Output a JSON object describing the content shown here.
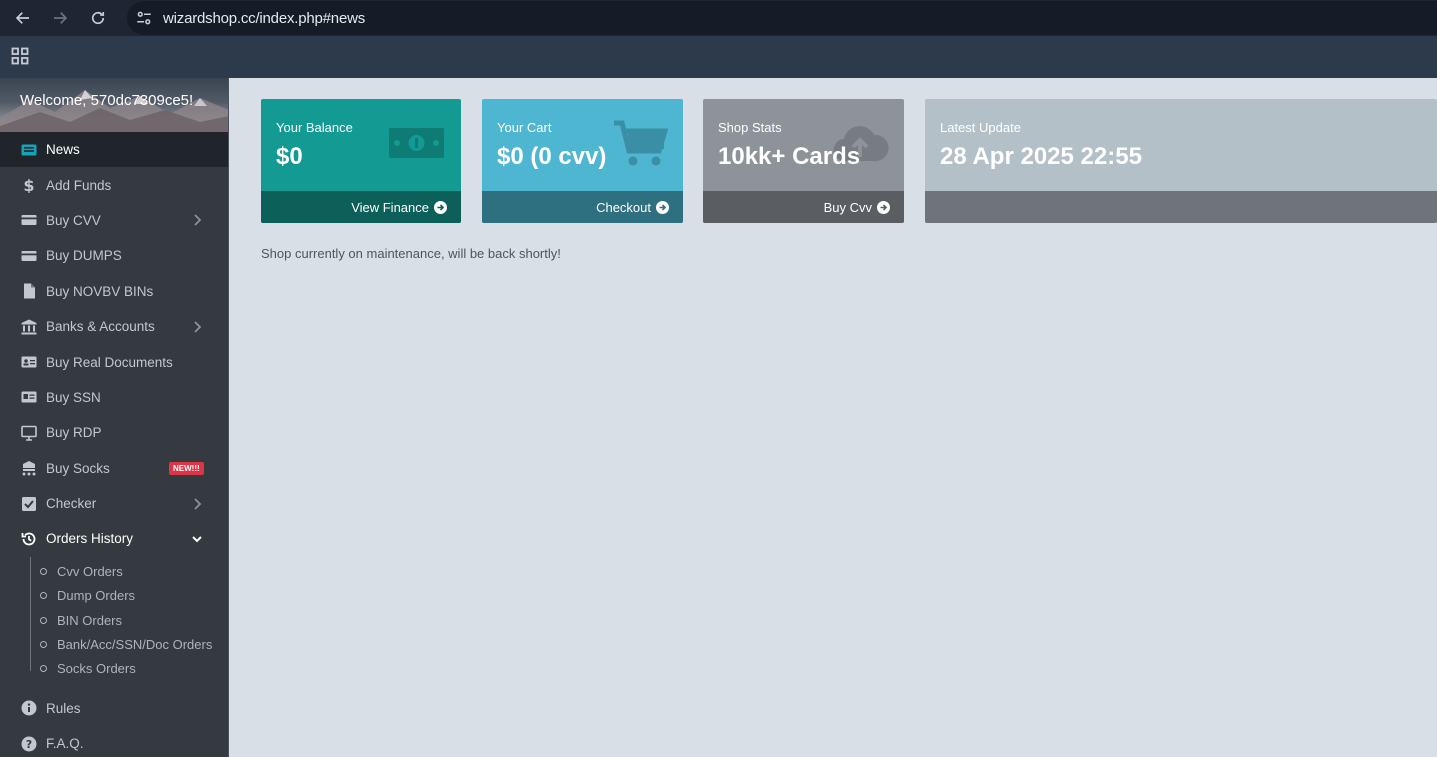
{
  "browser": {
    "url": "wizardshop.cc/index.php#news"
  },
  "sidebar": {
    "welcome": "Welcome, 570dc7309ce5!",
    "items": [
      {
        "label": "News",
        "icon": "newspaper-icon",
        "active": true
      },
      {
        "label": "Add Funds",
        "icon": "dollar-icon"
      },
      {
        "label": "Buy CVV",
        "icon": "credit-card-icon",
        "has_arrow": true
      },
      {
        "label": "Buy DUMPS",
        "icon": "credit-card-icon"
      },
      {
        "label": "Buy NOVBV BINs",
        "icon": "file-icon"
      },
      {
        "label": "Banks & Accounts",
        "icon": "bank-icon",
        "has_arrow": true
      },
      {
        "label": "Buy Real Documents",
        "icon": "id-card-icon"
      },
      {
        "label": "Buy SSN",
        "icon": "id-badge-icon"
      },
      {
        "label": "Buy RDP",
        "icon": "desktop-icon"
      },
      {
        "label": "Buy Socks",
        "icon": "network-icon",
        "badge": "NEW!!!"
      },
      {
        "label": "Checker",
        "icon": "check-square-icon",
        "has_arrow": true
      },
      {
        "label": "Orders History",
        "icon": "history-icon",
        "open": true
      }
    ],
    "orders_submenu": [
      {
        "label": "Cvv Orders"
      },
      {
        "label": "Dump Orders"
      },
      {
        "label": "BIN Orders"
      },
      {
        "label": "Bank/Acc/SSN/Doc Orders"
      },
      {
        "label": "Socks Orders"
      }
    ],
    "bottom_items": [
      {
        "label": "Rules",
        "icon": "info-circle-icon"
      },
      {
        "label": "F.A.Q.",
        "icon": "question-circle-icon"
      }
    ]
  },
  "boxes": {
    "balance": {
      "title": "Your Balance",
      "value": "$0",
      "link": "View Finance",
      "color": "#139a92"
    },
    "cart": {
      "title": "Your Cart",
      "value": "$0 (0 cvv)",
      "link": "Checkout",
      "color": "#4fb6d2"
    },
    "stats": {
      "title": "Shop Stats",
      "value": "10kk+ Cards",
      "link": "Buy Cvv",
      "color": "#8e9399"
    },
    "update": {
      "title": "Latest Update",
      "value": "28 Apr 2025 22:55",
      "color": "#b4c0c8"
    }
  },
  "notice": "Shop currently on maintenance, will be back shortly!"
}
